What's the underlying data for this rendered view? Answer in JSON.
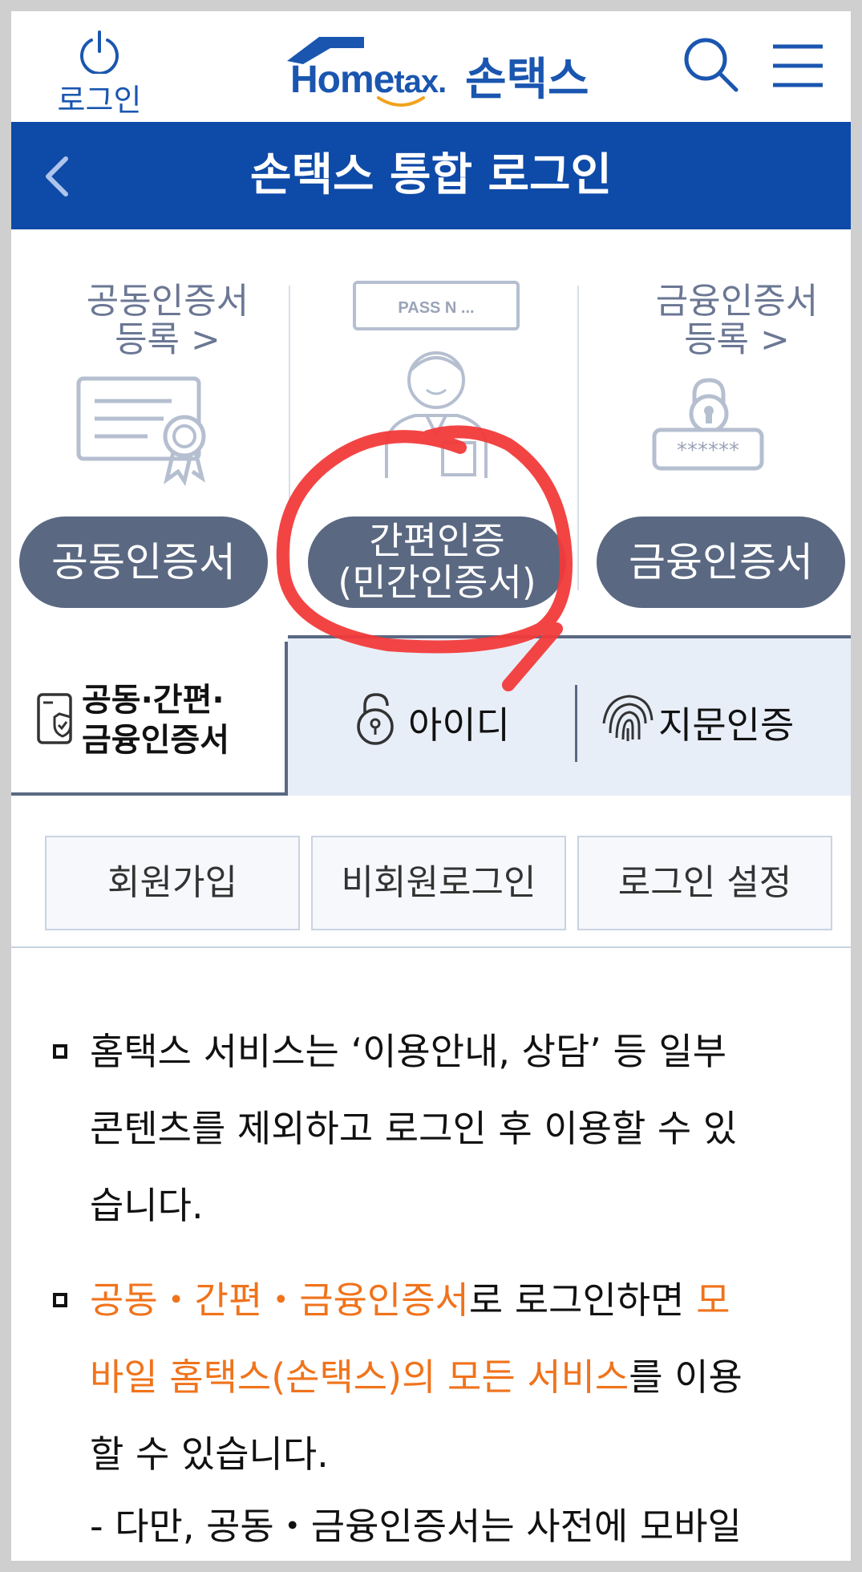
{
  "header": {
    "login_label": "로그인",
    "logo_home": "Home",
    "logo_tax": "tax.",
    "logo_sontax": "손택스"
  },
  "titlebar": {
    "title": "손택스 통합 로그인"
  },
  "certs": {
    "joint_register": [
      "공동인증서",
      "등록 >"
    ],
    "finance_register": [
      "금융인증서",
      "등록 >"
    ],
    "simple_badges": "PASS N ...",
    "finance_stars": "******",
    "joint_button": "공동인증서",
    "simple_button_line1": "간편인증",
    "simple_button_line2": "(민간인증서)",
    "finance_button": "금융인증서"
  },
  "tabs": {
    "cert_tab_line1": "공동·간편·",
    "cert_tab_line2": "금융인증서",
    "id_tab": "아이디",
    "fingerprint_tab": "지문인증"
  },
  "actions": {
    "join": "회원가입",
    "nonmember": "비회원로그인",
    "settings": "로그인 설정"
  },
  "notices": {
    "n1_line1": "홈택스 서비스는 ‘이용안내, 상담’ 등 일부",
    "n1_line2": "콘텐츠를 제외하고 로그인 후 이용할 수 있",
    "n1_line3": "습니다.",
    "n2_l1_orange": "공동・간편・금융인증서",
    "n2_l1_rest": "로 로그인하면 ",
    "n2_l1_orange2": "모",
    "n2_l2_orange": "바일 홈택스(손택스)의 모든 서비스",
    "n2_l2_rest": "를 이용",
    "n2_line3": "할 수 있습니다.",
    "n2_line4": "- 다만, 공동・금융인증서는 사전에 모바일"
  },
  "colors": {
    "brand_blue": "#0e4aa8",
    "pill_gray": "#5a6882",
    "highlight_orange": "#f0731c",
    "annotation_red": "#f23a3a"
  }
}
